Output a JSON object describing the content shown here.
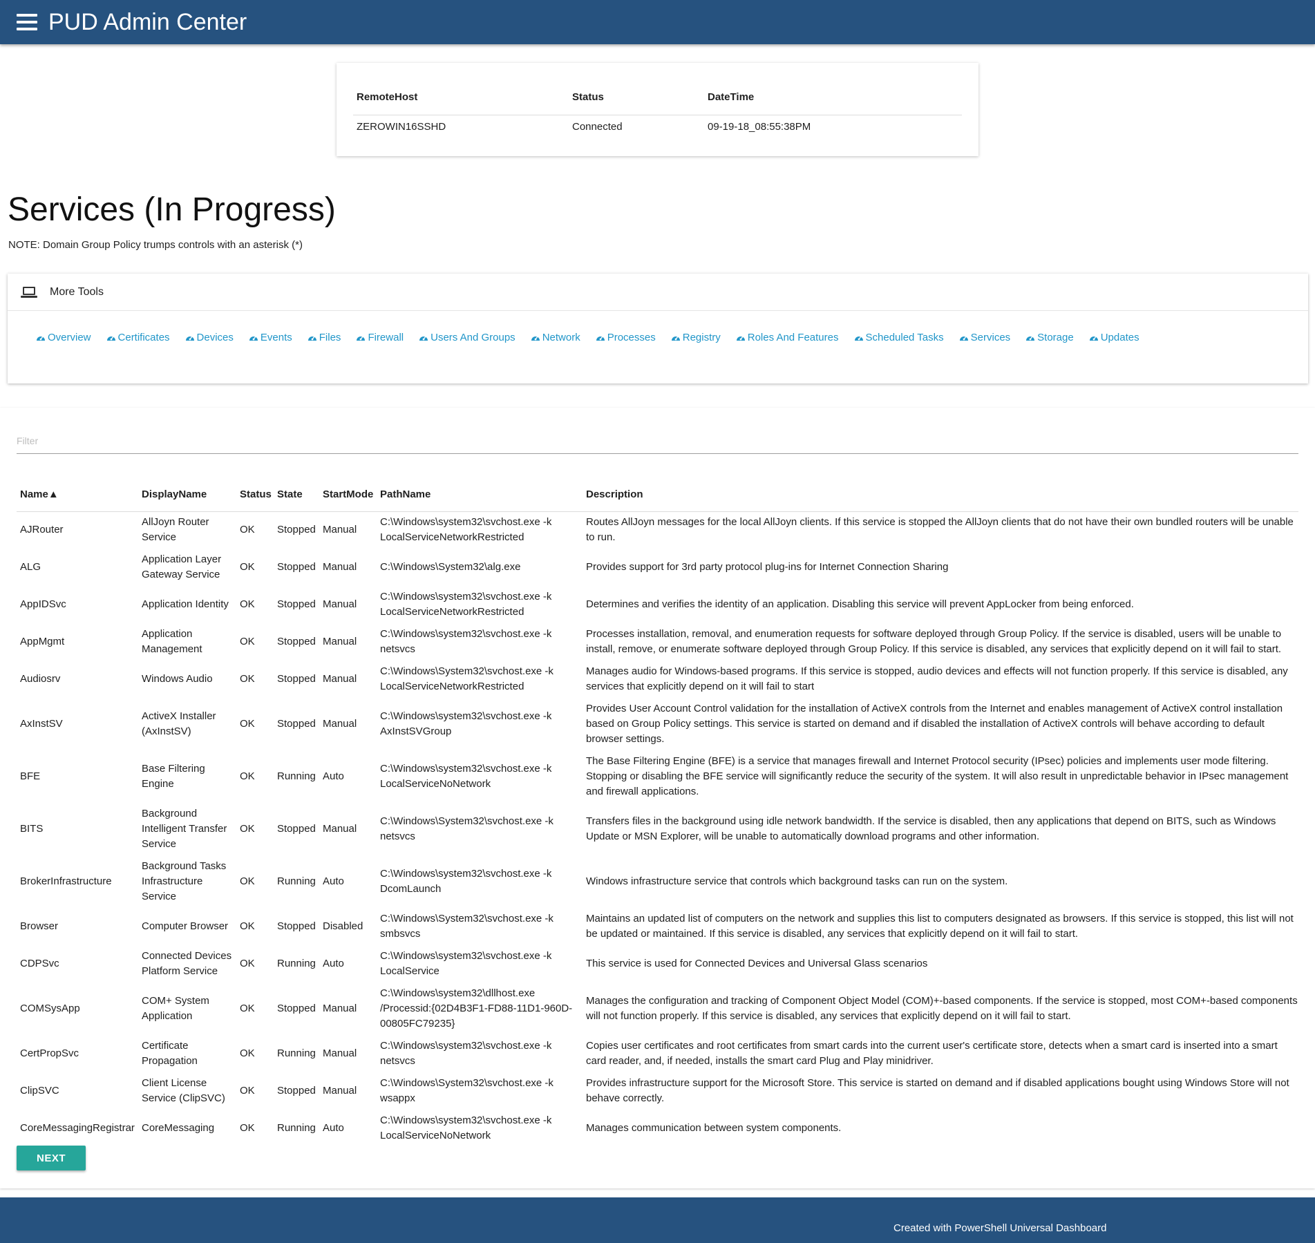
{
  "header": {
    "title": "PUD Admin Center"
  },
  "host_card": {
    "columns": [
      "RemoteHost",
      "Status",
      "DateTime"
    ],
    "row": {
      "remote_host": "ZEROWIN16SSHD",
      "status": "Connected",
      "datetime": "09-19-18_08:55:38PM"
    }
  },
  "page": {
    "title": "Services (In Progress)",
    "note": "NOTE: Domain Group Policy trumps controls with an asterisk (*)"
  },
  "tools": {
    "header_label": "More Tools",
    "links": [
      "Overview",
      "Certificates",
      "Devices",
      "Events",
      "Files",
      "Firewall",
      "Users And Groups",
      "Network",
      "Processes",
      "Registry",
      "Roles And Features",
      "Scheduled Tasks",
      "Services",
      "Storage",
      "Updates"
    ]
  },
  "filter": {
    "placeholder": "Filter",
    "value": ""
  },
  "services_table": {
    "columns": [
      "Name▲",
      "DisplayName",
      "Status",
      "State",
      "StartMode",
      "PathName",
      "Description"
    ],
    "rows": [
      {
        "name": "AJRouter",
        "display": "AllJoyn Router Service",
        "status": "OK",
        "state": "Stopped",
        "mode": "Manual",
        "path": "C:\\Windows\\system32\\svchost.exe -k LocalServiceNetworkRestricted",
        "desc": "Routes AllJoyn messages for the local AllJoyn clients. If this service is stopped the AllJoyn clients that do not have their own bundled routers will be unable to run."
      },
      {
        "name": "ALG",
        "display": "Application Layer Gateway Service",
        "status": "OK",
        "state": "Stopped",
        "mode": "Manual",
        "path": "C:\\Windows\\System32\\alg.exe",
        "desc": "Provides support for 3rd party protocol plug-ins for Internet Connection Sharing"
      },
      {
        "name": "AppIDSvc",
        "display": "Application Identity",
        "status": "OK",
        "state": "Stopped",
        "mode": "Manual",
        "path": "C:\\Windows\\system32\\svchost.exe -k LocalServiceNetworkRestricted",
        "desc": "Determines and verifies the identity of an application. Disabling this service will prevent AppLocker from being enforced."
      },
      {
        "name": "AppMgmt",
        "display": "Application Management",
        "status": "OK",
        "state": "Stopped",
        "mode": "Manual",
        "path": "C:\\Windows\\system32\\svchost.exe -k netsvcs",
        "desc": "Processes installation, removal, and enumeration requests for software deployed through Group Policy. If the service is disabled, users will be unable to install, remove, or enumerate software deployed through Group Policy. If this service is disabled, any services that explicitly depend on it will fail to start."
      },
      {
        "name": "Audiosrv",
        "display": "Windows Audio",
        "status": "OK",
        "state": "Stopped",
        "mode": "Manual",
        "path": "C:\\Windows\\System32\\svchost.exe -k LocalServiceNetworkRestricted",
        "desc": "Manages audio for Windows-based programs. If this service is stopped, audio devices and effects will not function properly. If this service is disabled, any services that explicitly depend on it will fail to start"
      },
      {
        "name": "AxInstSV",
        "display": "ActiveX Installer (AxInstSV)",
        "status": "OK",
        "state": "Stopped",
        "mode": "Manual",
        "path": "C:\\Windows\\system32\\svchost.exe -k AxInstSVGroup",
        "desc": "Provides User Account Control validation for the installation of ActiveX controls from the Internet and enables management of ActiveX control installation based on Group Policy settings. This service is started on demand and if disabled the installation of ActiveX controls will behave according to default browser settings."
      },
      {
        "name": "BFE",
        "display": "Base Filtering Engine",
        "status": "OK",
        "state": "Running",
        "mode": "Auto",
        "path": "C:\\Windows\\system32\\svchost.exe -k LocalServiceNoNetwork",
        "desc": "The Base Filtering Engine (BFE) is a service that manages firewall and Internet Protocol security (IPsec) policies and implements user mode filtering. Stopping or disabling the BFE service will significantly reduce the security of the system. It will also result in unpredictable behavior in IPsec management and firewall applications."
      },
      {
        "name": "BITS",
        "display": "Background Intelligent Transfer Service",
        "status": "OK",
        "state": "Stopped",
        "mode": "Manual",
        "path": "C:\\Windows\\System32\\svchost.exe -k netsvcs",
        "desc": "Transfers files in the background using idle network bandwidth. If the service is disabled, then any applications that depend on BITS, such as Windows Update or MSN Explorer, will be unable to automatically download programs and other information."
      },
      {
        "name": "BrokerInfrastructure",
        "display": "Background Tasks Infrastructure Service",
        "status": "OK",
        "state": "Running",
        "mode": "Auto",
        "path": "C:\\Windows\\system32\\svchost.exe -k DcomLaunch",
        "desc": "Windows infrastructure service that controls which background tasks can run on the system."
      },
      {
        "name": "Browser",
        "display": "Computer Browser",
        "status": "OK",
        "state": "Stopped",
        "mode": "Disabled",
        "path": "C:\\Windows\\System32\\svchost.exe -k smbsvcs",
        "desc": "Maintains an updated list of computers on the network and supplies this list to computers designated as browsers. If this service is stopped, this list will not be updated or maintained. If this service is disabled, any services that explicitly depend on it will fail to start."
      },
      {
        "name": "CDPSvc",
        "display": "Connected Devices Platform Service",
        "status": "OK",
        "state": "Running",
        "mode": "Auto",
        "path": "C:\\Windows\\system32\\svchost.exe -k LocalService",
        "desc": "This service is used for Connected Devices and Universal Glass scenarios"
      },
      {
        "name": "COMSysApp",
        "display": "COM+ System Application",
        "status": "OK",
        "state": "Stopped",
        "mode": "Manual",
        "path": "C:\\Windows\\system32\\dllhost.exe /Processid:{02D4B3F1-FD88-11D1-960D-00805FC79235}",
        "desc": "Manages the configuration and tracking of Component Object Model (COM)+-based components. If the service is stopped, most COM+-based components will not function properly. If this service is disabled, any services that explicitly depend on it will fail to start."
      },
      {
        "name": "CertPropSvc",
        "display": "Certificate Propagation",
        "status": "OK",
        "state": "Running",
        "mode": "Manual",
        "path": "C:\\Windows\\system32\\svchost.exe -k netsvcs",
        "desc": "Copies user certificates and root certificates from smart cards into the current user's certificate store, detects when a smart card is inserted into a smart card reader, and, if needed, installs the smart card Plug and Play minidriver."
      },
      {
        "name": "ClipSVC",
        "display": "Client License Service (ClipSVC)",
        "status": "OK",
        "state": "Stopped",
        "mode": "Manual",
        "path": "C:\\Windows\\System32\\svchost.exe -k wsappx",
        "desc": "Provides infrastructure support for the Microsoft Store. This service is started on demand and if disabled applications bought using Windows Store will not behave correctly."
      },
      {
        "name": "CoreMessagingRegistrar",
        "display": "CoreMessaging",
        "status": "OK",
        "state": "Running",
        "mode": "Auto",
        "path": "C:\\Windows\\system32\\svchost.exe -k LocalServiceNoNetwork",
        "desc": "Manages communication between system components."
      }
    ]
  },
  "pagination": {
    "next_label": "NEXT"
  },
  "footer": {
    "text": "Created with PowerShell Universal Dashboard"
  },
  "colors": {
    "header_bg": "#26527f",
    "link": "#2196c9",
    "button": "#26a69a"
  }
}
